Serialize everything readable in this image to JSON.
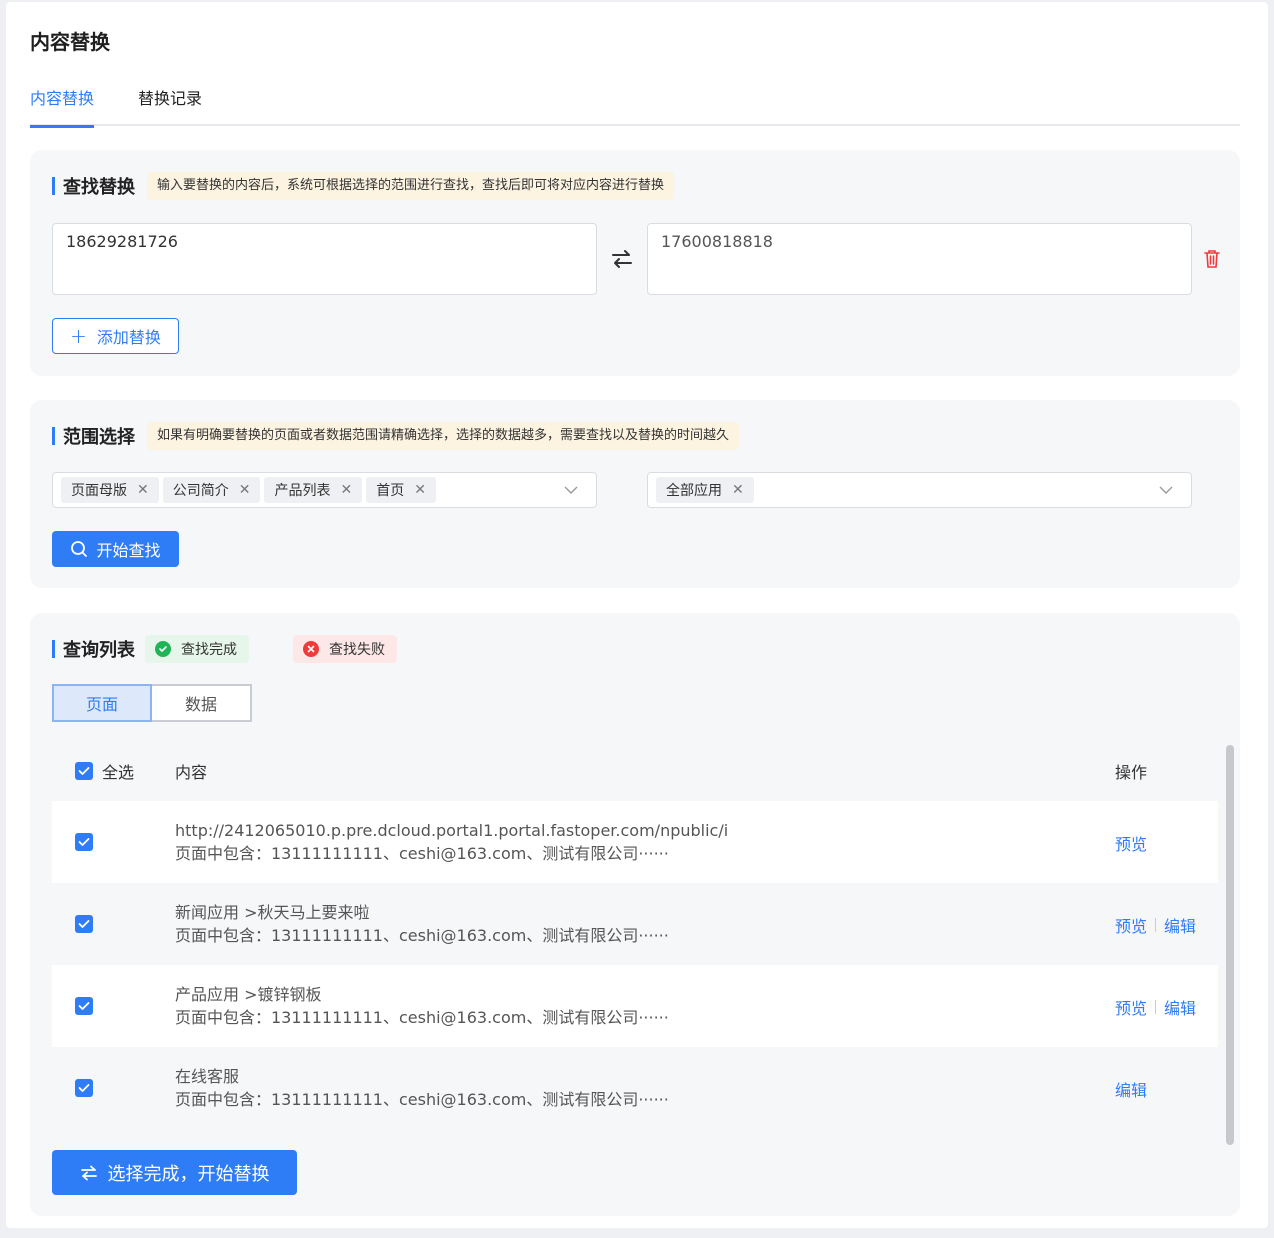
{
  "page": {
    "title": "内容替换"
  },
  "tabs": [
    {
      "label": "内容替换",
      "active": true
    },
    {
      "label": "替换记录",
      "active": false
    }
  ],
  "find_replace": {
    "title": "查找替换",
    "hint": "输入要替换的内容后，系统可根据选择的范围进行查找，查找后即可将对应内容进行替换",
    "find_value": "18629281726",
    "replace_value": "17600818818",
    "add_button": "添加替换"
  },
  "scope": {
    "title": "范围选择",
    "hint": "如果有明确要替换的页面或者数据范围请精确选择，选择的数据越多，需要查找以及替换的时间越久",
    "left_tags": [
      "页面母版",
      "公司简介",
      "产品列表",
      "首页"
    ],
    "right_tags": [
      "全部应用"
    ],
    "search_button": "开始查找"
  },
  "results": {
    "title": "查询列表",
    "status_ok": "查找完成",
    "status_fail": "查找失败",
    "segments": [
      "页面",
      "数据"
    ],
    "header": {
      "select_all": "全选",
      "content": "内容",
      "operation": "操作"
    },
    "rows": [
      {
        "line1": "http://2412065010.p.pre.dcloud.portal1.portal.fastoper.com/npublic/i",
        "line2": "页面中包含：13111111111、ceshi@163.com、测试有限公司······",
        "preview": "预览",
        "edit": ""
      },
      {
        "line1": "新闻应用 >秋天马上要来啦",
        "line2": "页面中包含：13111111111、ceshi@163.com、测试有限公司······",
        "preview": "预览",
        "edit": "编辑"
      },
      {
        "line1": "产品应用 >镀锌钢板",
        "line2": "页面中包含：13111111111、ceshi@163.com、测试有限公司······",
        "preview": "预览",
        "edit": "编辑"
      },
      {
        "line1": "在线客服",
        "line2": "页面中包含：13111111111、ceshi@163.com、测试有限公司······",
        "preview": "",
        "edit": "编辑"
      }
    ],
    "replace_button": "选择完成，开始替换"
  },
  "colors": {
    "accent": "#2f7df6",
    "success": "#1fb455",
    "danger": "#ef3b3b",
    "hint_bg": "#fdf3e1"
  }
}
